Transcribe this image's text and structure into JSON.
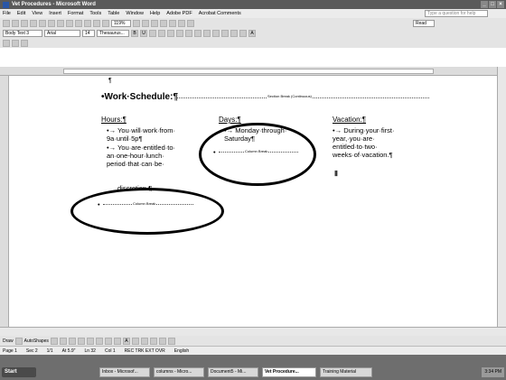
{
  "window": {
    "title": "Vet Procedures - Microsoft Word"
  },
  "menu": {
    "items": [
      "File",
      "Edit",
      "View",
      "Insert",
      "Format",
      "Tools",
      "Table",
      "Window",
      "Help",
      "Adobe PDF",
      "Acrobat Comments"
    ],
    "help_placeholder": "Type a question for help"
  },
  "format_toolbar": {
    "style": "Body Text 3",
    "font": "Arial",
    "size": "14",
    "thesaurus": "Thesaurus..."
  },
  "standard_toolbar": {
    "zoom": "119%",
    "read_label": "Read"
  },
  "document": {
    "pilcrow_top": "¶",
    "heading": "•Work·Schedule:¶",
    "section_break_label": "Section Break (Continuous)",
    "column1": {
      "header": "Hours:¶",
      "bullets": [
        "You·will·work·from· 9a·until·5p¶",
        "You·are·entitled·to· an·one-hour·lunch· period·that·can·be·"
      ],
      "tail": "discretion.¶",
      "break_label": "Column Break"
    },
    "column2": {
      "header": "Days:¶",
      "bullets": [
        "Monday·through· Saturday¶"
      ],
      "break_label": "Column Break"
    },
    "column3": {
      "header": "Vacation:¶",
      "bullets": [
        "During·your·first· year,·you·are· entitled·to·two· weeks·of·vacation.¶"
      ]
    }
  },
  "statusbar": {
    "page": "Page 1",
    "sec": "Sec 2",
    "pages": "1/1",
    "at": "At 5.9\"",
    "ln": "Ln 32",
    "col": "Col 1",
    "modes": "REC  TRK  EXT  OVR",
    "lang": "English"
  },
  "drawbar": {
    "draw": "Draw",
    "autoshapes": "AutoShapes"
  },
  "taskbar": {
    "start": "Start",
    "tasks": [
      "Inbox - Microsof...",
      "columns - Micro...",
      "Document5 - Mi...",
      "Vet Procedure...",
      "Training Material"
    ],
    "clock": "3:34 PM"
  },
  "colors": {
    "annotation": "#000000",
    "chrome": "#e4e4e4"
  }
}
